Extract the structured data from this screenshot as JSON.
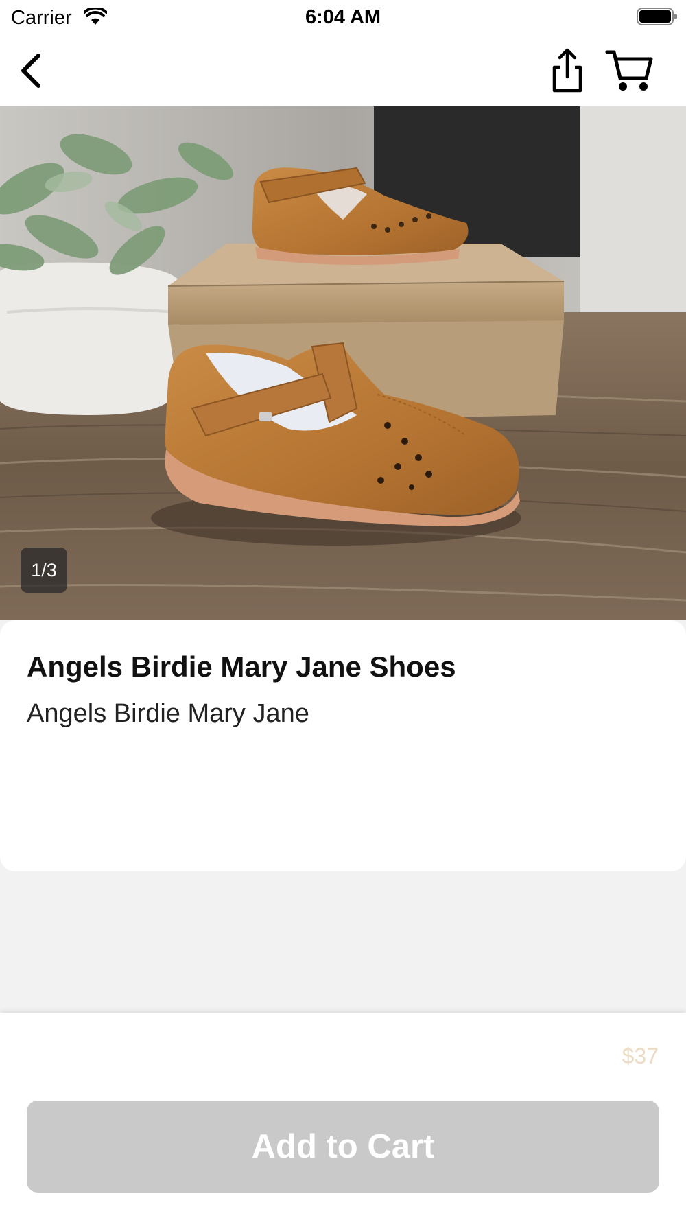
{
  "status_bar": {
    "carrier": "Carrier",
    "time": "6:04 AM"
  },
  "nav": {
    "back_icon": "chevron-left-icon",
    "share_icon": "share-icon",
    "cart_icon": "cart-icon"
  },
  "gallery": {
    "counter": "1/3",
    "image": "tan Mary Jane shoes on a cardboard box"
  },
  "product": {
    "title": "Angels Birdie Mary Jane Shoes",
    "subtitle": "Angels Birdie Mary Jane",
    "price": "$37"
  },
  "actions": {
    "add_to_cart_label": "Add to Cart"
  },
  "colors": {
    "price": "#ecdcc5",
    "button_bg": "#c9c9c9",
    "button_text": "#ffffff",
    "page_bg": "#f2f2f2"
  }
}
